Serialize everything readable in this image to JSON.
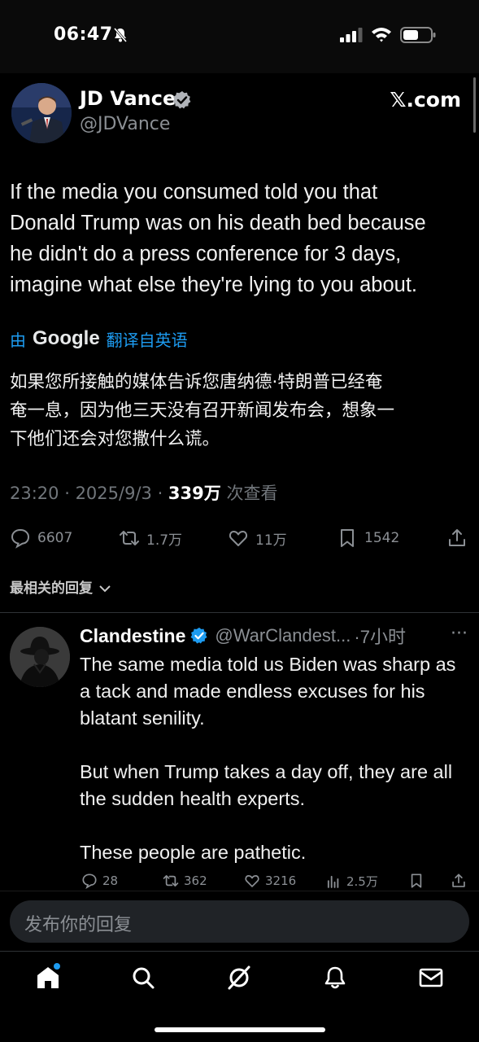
{
  "status_bar": {
    "time": "06:47",
    "icons": [
      "bell-off-icon",
      "signal-icon",
      "wifi-icon",
      "battery-icon"
    ]
  },
  "tweet": {
    "author_name": "JD Vance",
    "author_handle": "@JDVance",
    "site_label": "𝕏.com",
    "text_lines": [
      "If the media you consumed told you that",
      "Donald Trump was on his death bed because",
      "he didn't do a press conference for 3 days,",
      "imagine what else they're lying to you about."
    ],
    "translate": {
      "by": "由",
      "provider": "Google",
      "link": "翻译自英语"
    },
    "translated_lines": [
      "如果您所接触的媒体告诉您唐纳德·特朗普已经奄",
      "奄一息，因为他三天没有召开新闻发布会，想象一",
      "下他们还会对您撒什么谎。"
    ],
    "meta": {
      "time": "23:20",
      "sep1": " · ",
      "date": "2025/9/3",
      "sep2": " · ",
      "views": "339万",
      "views_label": " 次查看"
    },
    "actions": {
      "replies": "6607",
      "reposts": "1.7万",
      "likes": "11万",
      "bookmarks": "1542"
    }
  },
  "replies_header": "最相关的回复",
  "reply": {
    "name": "Clandestine",
    "handle": "@WarClandest...",
    "time": "·7小时",
    "more": "···",
    "paragraphs": [
      "The same media told us Biden was sharp as a tack and made endless excuses for his blatant senility.",
      "But when Trump takes a day off, they are all the sudden health experts.",
      "These people are pathetic."
    ],
    "actions": {
      "replies": "28",
      "reposts": "362",
      "likes": "3216",
      "views": "2.5万"
    }
  },
  "composer": {
    "placeholder": "发布你的回复"
  },
  "bottom_nav": [
    "home-icon",
    "search-icon",
    "grok-icon",
    "notifications-icon",
    "messages-icon"
  ],
  "colors": {
    "background": "#000000",
    "accent": "#1d9bf0",
    "muted": "#71767b",
    "text": "#e7e9ea"
  }
}
